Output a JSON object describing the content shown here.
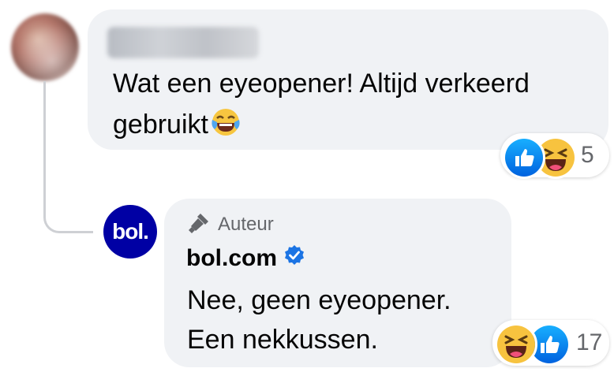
{
  "comment": {
    "author_name": "",
    "text_line1": "Wat een eyeopener! Altijd verkeerd",
    "text_line2": "gebruikt",
    "reactions": {
      "types": [
        "like",
        "haha"
      ],
      "count": "5"
    }
  },
  "reply": {
    "badge_label": "Auteur",
    "page_name": "bol.com",
    "avatar_text": "bol.",
    "text_line1": "Nee, geen eyeopener.",
    "text_line2": "Een nekkussen.",
    "reactions": {
      "types": [
        "haha",
        "like"
      ],
      "count": "17"
    }
  },
  "colors": {
    "bubble": "#f0f2f5",
    "like_blue": "#1877f2",
    "bol_blue": "#0000a4",
    "muted_text": "#65676b",
    "verified_blue": "#1b74e4"
  },
  "icons": [
    "like-icon",
    "haha-icon",
    "tears-of-joy-emoji-icon",
    "microphone-icon",
    "verified-badge-icon"
  ]
}
